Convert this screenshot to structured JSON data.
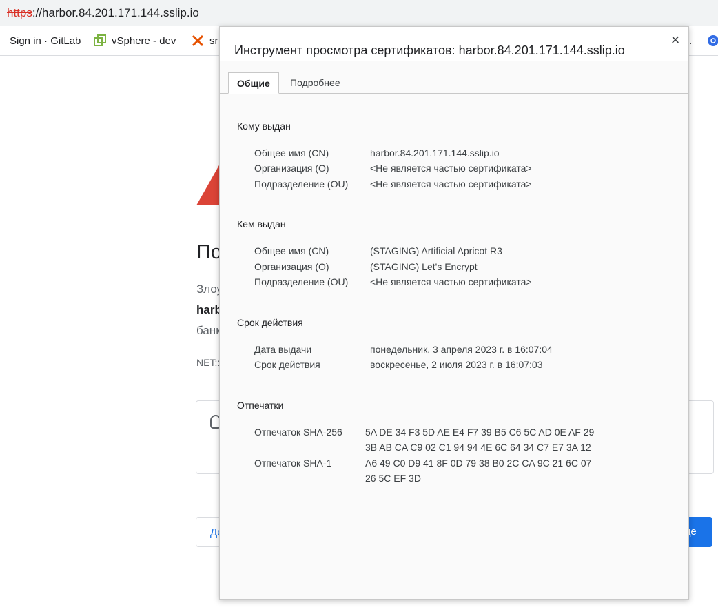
{
  "browser": {
    "url_scheme": "https",
    "url_rest": "://harbor.84.201.171.144.sslip.io",
    "bookmarks": [
      {
        "label": "Sign in · GitLab",
        "icon": "gitlab-icon"
      },
      {
        "label": "vSphere - dev",
        "icon": "vsphere-icon"
      },
      {
        "label": "sr",
        "icon": "x-icon"
      }
    ]
  },
  "error_page": {
    "heading": "По",
    "line1": "Злоу",
    "line2": "harb",
    "line3": "банк",
    "code": "NET::",
    "left_button": "До",
    "right_button": "це"
  },
  "dialog": {
    "title": "Инструмент просмотра сертификатов: harbor.84.201.171.144.sslip.io",
    "close": "×",
    "tabs": {
      "general": "Общие",
      "details": "Подробнее"
    },
    "issued_to": {
      "title": "Кому выдан",
      "cn_label": "Общее имя (CN)",
      "cn_value": "harbor.84.201.171.144.sslip.io",
      "o_label": "Организация (O)",
      "o_value": "<Не является частью сертификата>",
      "ou_label": "Подразделение (OU)",
      "ou_value": "<Не является частью сертификата>"
    },
    "issued_by": {
      "title": "Кем выдан",
      "cn_label": "Общее имя (CN)",
      "cn_value": "(STAGING) Artificial Apricot R3",
      "o_label": "Организация (O)",
      "o_value": "(STAGING) Let's Encrypt",
      "ou_label": "Подразделение (OU)",
      "ou_value": "<Не является частью сертификата>"
    },
    "validity": {
      "title": "Срок действия",
      "issued_label": "Дата выдачи",
      "issued_value": "понедельник, 3 апреля 2023 г. в 16:07:04",
      "expires_label": "Срок действия",
      "expires_value": "воскресенье, 2 июля 2023 г. в 16:07:03"
    },
    "fingerprints": {
      "title": "Отпечатки",
      "sha256_label": "Отпечаток SHA-256",
      "sha256_value": "5A DE 34 F3 5D AE E4 F7 39 B5 C6 5C AD 0E AF 29 3B AB CA C9 02 C1 94 94 4E 6C 64 34 C7 E7 3A 12",
      "sha1_label": "Отпечаток SHA-1",
      "sha1_value": "A6 49 C0 D9 41 8F 0D 79 38 B0 2C CA 9C 21 6C 07 26 5C EF 3D"
    }
  }
}
